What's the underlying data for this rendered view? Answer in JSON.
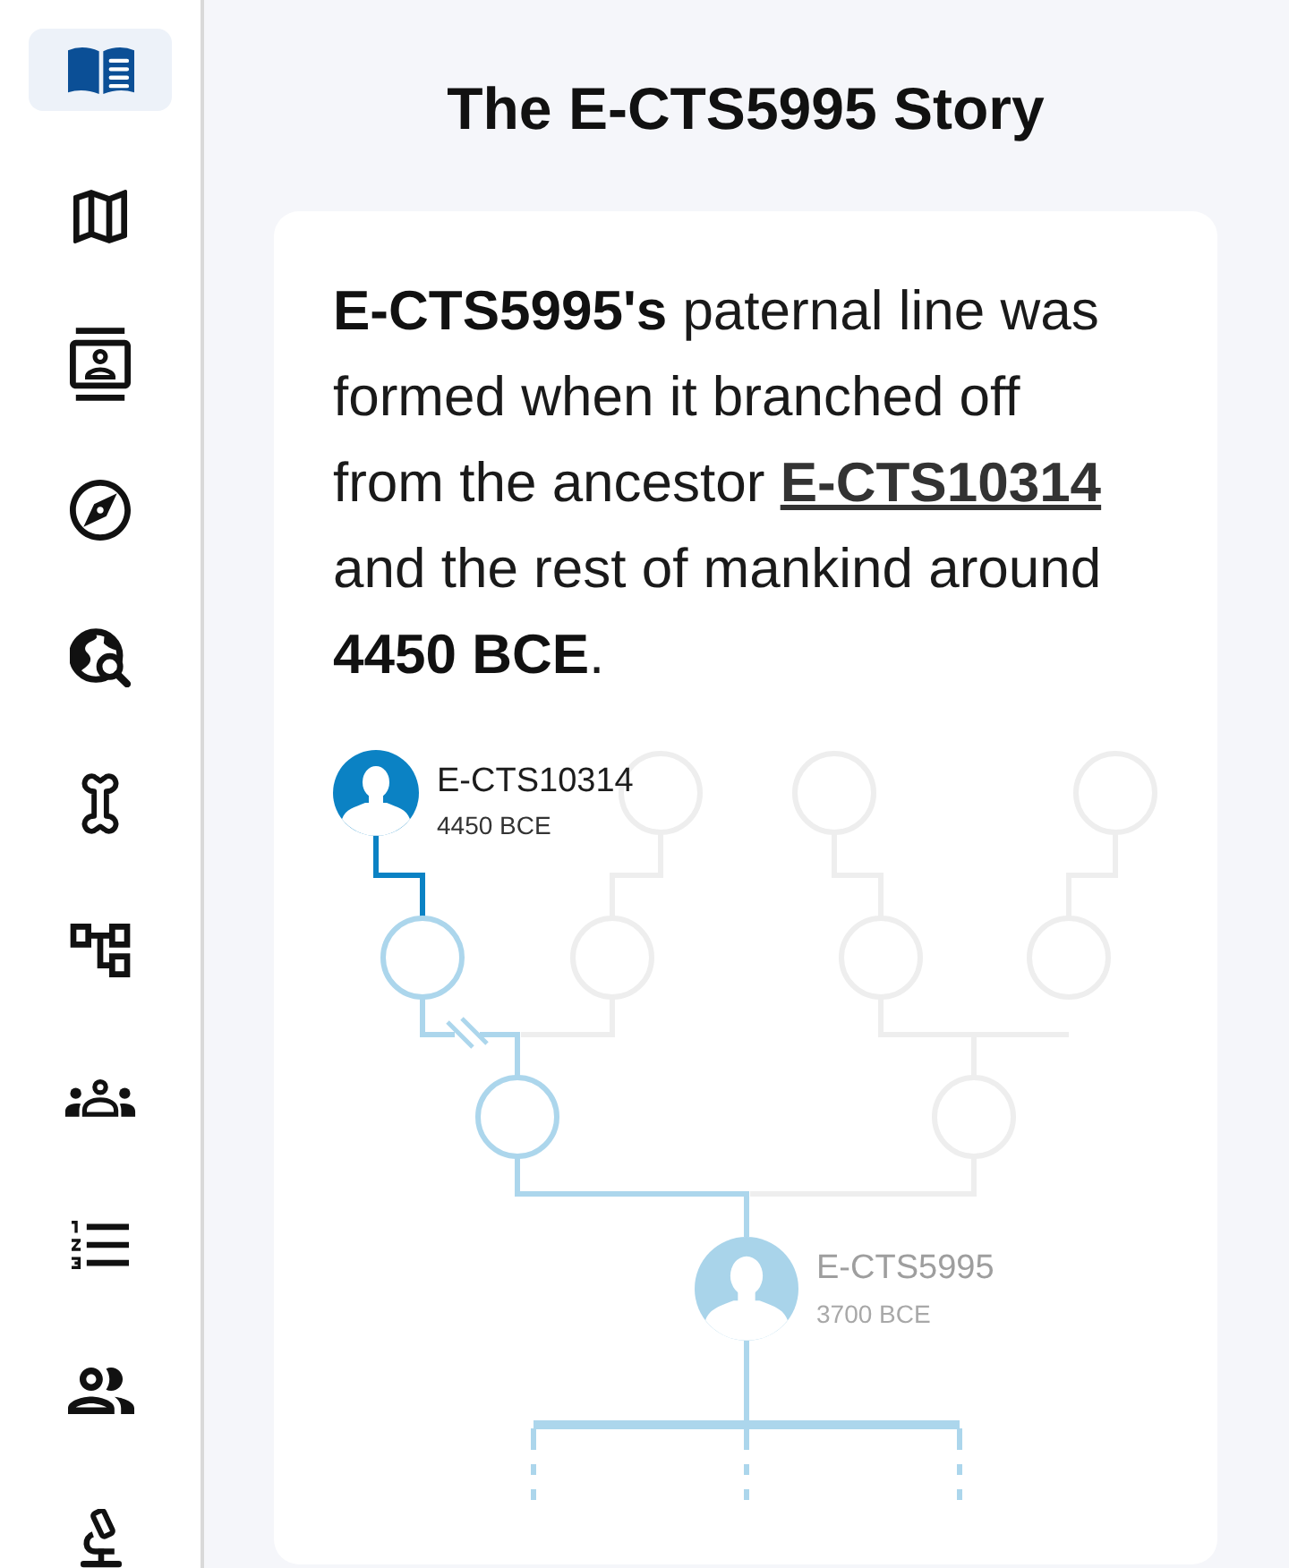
{
  "sidebar": {
    "items": [
      {
        "selected": true
      },
      {
        "selected": false
      },
      {
        "selected": false
      },
      {
        "selected": false
      },
      {
        "selected": false
      },
      {
        "selected": false
      },
      {
        "selected": false
      },
      {
        "selected": false
      },
      {
        "selected": false
      },
      {
        "selected": false
      },
      {
        "selected": false
      }
    ]
  },
  "page": {
    "title": "The E-CTS5995 Story"
  },
  "story": {
    "before": "**E-CTS5995's** paternal line was formed when it branched off from the ancestor",
    "link": "E-CTS10314",
    "after": "and the rest of mankind around **4450 BCE**."
  },
  "tree": {
    "nodes": [
      {
        "kind": "ancestor",
        "name": "E-CTS10314",
        "date": "4450 BCE"
      },
      {
        "kind": "descendant",
        "name": "E-CTS5995",
        "date": "3700 BCE"
      }
    ]
  }
}
